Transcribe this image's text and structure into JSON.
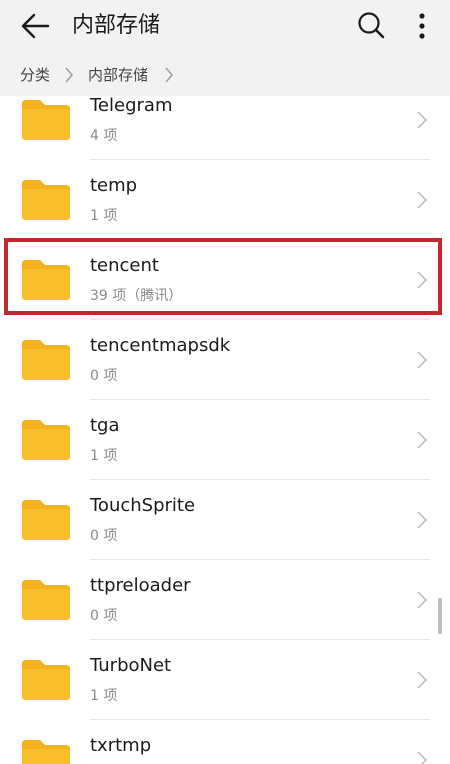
{
  "header": {
    "title": "内部存储",
    "back_icon": "arrow-left-icon",
    "search_icon": "search-icon",
    "more_icon": "more-vertical-icon"
  },
  "breadcrumb": {
    "items": [
      "分类",
      "内部存储"
    ]
  },
  "colors": {
    "folder": "#f9bf2a",
    "folder_tab": "#f6b21d",
    "highlight": "#c4272e"
  },
  "files": [
    {
      "name": "Telegram",
      "meta": "4 项"
    },
    {
      "name": "temp",
      "meta": "1 项"
    },
    {
      "name": "tencent",
      "meta": "39 项（腾讯）"
    },
    {
      "name": "tencentmapsdk",
      "meta": "0 项"
    },
    {
      "name": "tga",
      "meta": "1 项"
    },
    {
      "name": "TouchSprite",
      "meta": "0 项"
    },
    {
      "name": "ttpreloader",
      "meta": "0 项"
    },
    {
      "name": "TurboNet",
      "meta": "1 项"
    },
    {
      "name": "txrtmp",
      "meta": ""
    }
  ]
}
